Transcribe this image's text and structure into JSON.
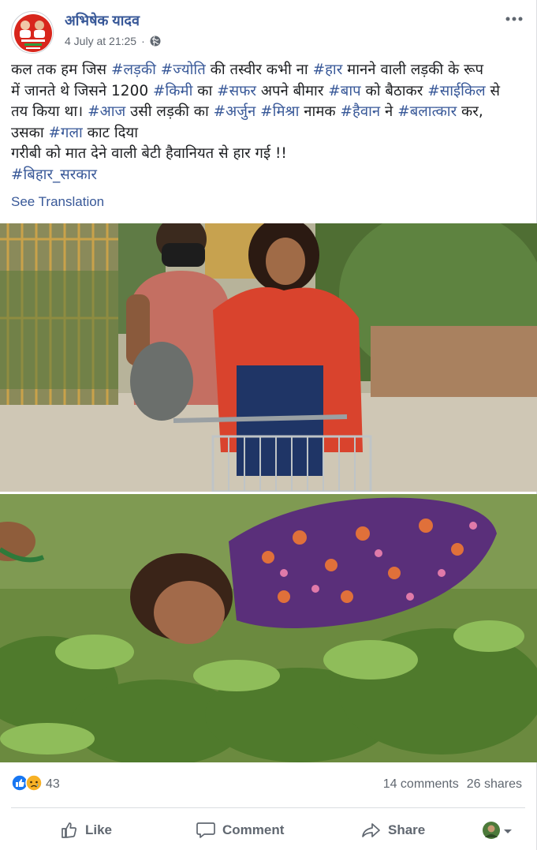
{
  "post": {
    "author": "अभिषेक यादव",
    "timestamp": "4 July at 21:25",
    "separator": "·",
    "lines": [
      [
        {
          "t": "कल तक हम जिस ",
          "tag": false
        },
        {
          "t": "#लड़की",
          "tag": true
        },
        {
          "t": " ",
          "tag": false
        },
        {
          "t": "#ज्योति",
          "tag": true
        },
        {
          "t": " की तस्वीर कभी ना ",
          "tag": false
        },
        {
          "t": "#हार",
          "tag": true
        },
        {
          "t": " मानने वाली लड़की के रूप",
          "tag": false
        }
      ],
      [
        {
          "t": "में जानते थे जिसने 1200 ",
          "tag": false
        },
        {
          "t": "#किमी",
          "tag": true
        },
        {
          "t": " का ",
          "tag": false
        },
        {
          "t": "#सफर",
          "tag": true
        },
        {
          "t": " अपने बीमार ",
          "tag": false
        },
        {
          "t": "#बाप",
          "tag": true
        },
        {
          "t": " को बैठाकर ",
          "tag": false
        },
        {
          "t": "#साईकिल",
          "tag": true
        },
        {
          "t": " से",
          "tag": false
        }
      ],
      [
        {
          "t": "तय किया था। ",
          "tag": false
        },
        {
          "t": "#आज",
          "tag": true
        },
        {
          "t": " उसी लड़की का ",
          "tag": false
        },
        {
          "t": "#अर्जुन",
          "tag": true
        },
        {
          "t": " ",
          "tag": false
        },
        {
          "t": "#मिश्रा",
          "tag": true
        },
        {
          "t": " नामक ",
          "tag": false
        },
        {
          "t": "#हैवान",
          "tag": true
        },
        {
          "t": " ने ",
          "tag": false
        },
        {
          "t": "#बलात्कार",
          "tag": true
        },
        {
          "t": " कर,",
          "tag": false
        }
      ],
      [
        {
          "t": "उसका ",
          "tag": false
        },
        {
          "t": "#गला",
          "tag": true
        },
        {
          "t": " काट दिया",
          "tag": false
        }
      ],
      [
        {
          "t": "गरीबी को मात देने वाली बेटी हैवानियत से हार गई !!",
          "tag": false
        }
      ],
      [
        {
          "t": "#बिहार_सरकार",
          "tag": true
        }
      ]
    ],
    "see_translation": "See Translation"
  },
  "engagement": {
    "reaction_count": "43",
    "comments": "14 comments",
    "shares": "26 shares"
  },
  "actions": {
    "like": "Like",
    "comment": "Comment",
    "share": "Share"
  },
  "colors": {
    "link": "#385898",
    "secondary_text": "#606770",
    "like_blue": "#1877f2",
    "sad_yellow": "#f7b125"
  },
  "icons": [
    "globe-icon",
    "more-icon",
    "like-reaction-icon",
    "sad-reaction-icon",
    "like-icon",
    "comment-icon",
    "share-icon",
    "caret-down-icon"
  ]
}
